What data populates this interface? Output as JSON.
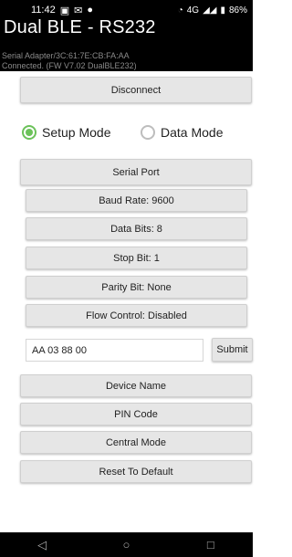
{
  "status_bar": {
    "time": "11:42",
    "notif_icons": [
      "notification-icon",
      "mail-icon",
      "chat-icon"
    ],
    "right_text": "4G",
    "battery": "86%"
  },
  "app": {
    "title": "Dual BLE - RS232",
    "subtitle_line1": "Serial Adapter/3C:61:7E:CB:FA:AA",
    "subtitle_line2": "Connected. (FW V7.02 DualBLE232)"
  },
  "buttons": {
    "disconnect": "Disconnect",
    "serial_port": "Serial Port",
    "baud_rate": "Baud Rate: 9600",
    "data_bits": "Data Bits: 8",
    "stop_bit": "Stop Bit: 1",
    "parity_bit": "Parity Bit: None",
    "flow_control": "Flow Control: Disabled",
    "submit": "Submit",
    "device_name": "Device Name",
    "pin_code": "PIN Code",
    "central_mode": "Central Mode",
    "reset": "Reset To Default"
  },
  "mode": {
    "setup_label": "Setup Mode",
    "data_label": "Data Mode",
    "selected": "setup"
  },
  "command_input": {
    "value": "AA 03 88 00"
  },
  "colors": {
    "radio_selected": "#6cc25a",
    "button_bg": "#e6e6e6",
    "header_bg": "#000000"
  },
  "nav": {
    "back": "◁",
    "home": "○",
    "recents": "□"
  }
}
